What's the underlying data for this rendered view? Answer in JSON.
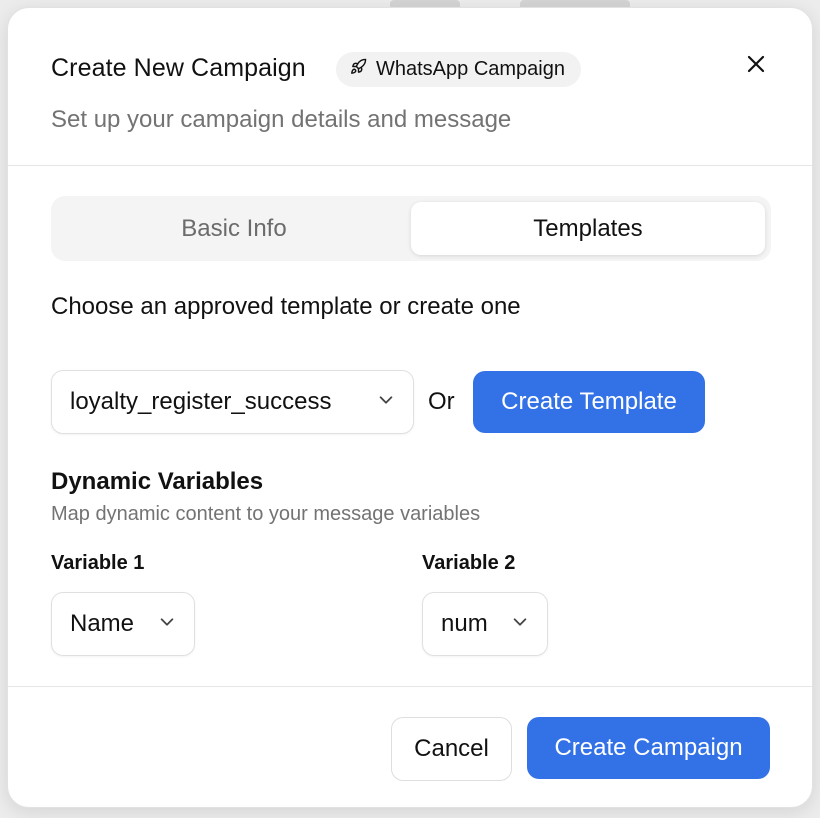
{
  "dialog": {
    "title": "Create New Campaign",
    "badge": {
      "label": "WhatsApp Campaign",
      "icon": "rocket-icon"
    },
    "subtitle": "Set up your campaign details and message",
    "close_icon": "close-icon"
  },
  "tabs": [
    {
      "label": "Basic Info",
      "active": false
    },
    {
      "label": "Templates",
      "active": true
    }
  ],
  "template_section": {
    "label": "Choose an approved template or create one",
    "selected_template": "loyalty_register_success",
    "or_text": "Or",
    "create_template_label": "Create Template"
  },
  "dynamic_variables": {
    "title": "Dynamic Variables",
    "subtitle": "Map dynamic content to your message variables",
    "variables": [
      {
        "label": "Variable 1",
        "value": "Name"
      },
      {
        "label": "Variable 2",
        "value": "num"
      }
    ]
  },
  "footer": {
    "cancel_label": "Cancel",
    "submit_label": "Create Campaign"
  },
  "colors": {
    "primary": "#3372e6",
    "muted_text": "#737373"
  }
}
